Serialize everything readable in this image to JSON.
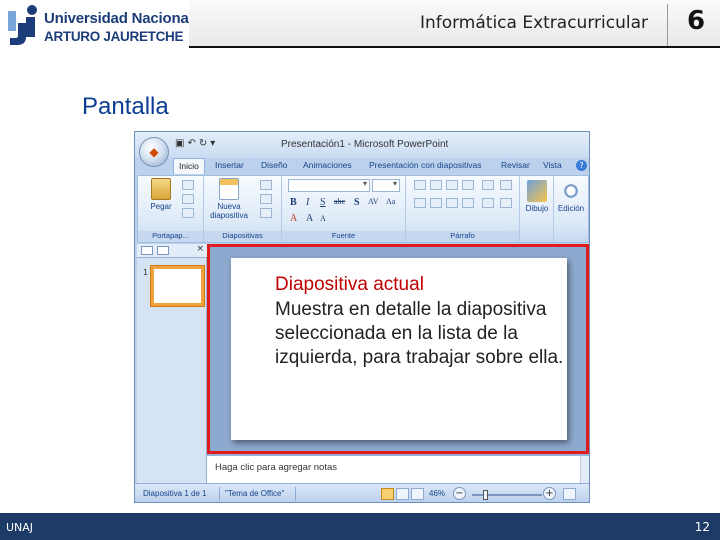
{
  "header": {
    "logo_line1": "Universidad Nacional",
    "logo_line2": "ARTURO JAURETCHE",
    "course_title": "Informática Extracurricular",
    "chapter_number": "6"
  },
  "slide": {
    "heading": "Pantalla"
  },
  "ppt": {
    "window_title": "Presentación1 - Microsoft PowerPoint",
    "tabs": [
      "Inicio",
      "Insertar",
      "Diseño",
      "Animaciones",
      "Presentación con diapositivas",
      "Revisar",
      "Vista"
    ],
    "active_tab": "Inicio",
    "ribbon": {
      "paste_label": "Pegar",
      "new_slide_label": "Nueva diapositiva",
      "drawing_label": "Dibujo",
      "editing_label": "Edición",
      "groups": [
        "Portapap...",
        "Diapositivas",
        "Fuente",
        "Párrafo"
      ]
    },
    "callout": {
      "title": "Diapositiva actual",
      "body": "Muestra en detalle la diapositiva seleccionada en la lista de la izquierda, para trabajar sobre ella."
    },
    "thumbnail_number": "1",
    "notes_placeholder": "Haga clic para agregar notas",
    "status": {
      "slide_info": "Diapositiva 1 de 1",
      "theme": "\"Tema de Office\"",
      "zoom": "46%",
      "zoom_level": 0.46
    }
  },
  "footer": {
    "left": "UNAJ",
    "page_number": "12"
  },
  "colors": {
    "brand_blue": "#1c3d7a",
    "footer_bar": "#1c3b66",
    "highlight_red": "#e01b1b",
    "callout_red": "#c00000"
  },
  "icons": [
    "university-logo-icon",
    "office-button-icon",
    "save-icon",
    "undo-icon",
    "redo-icon",
    "help-icon",
    "paste-icon",
    "new-slide-icon",
    "drawing-icon",
    "editing-icon",
    "view-normal-icon",
    "view-sorter-icon",
    "view-show-icon",
    "zoom-out-icon",
    "zoom-in-icon",
    "fit-window-icon"
  ]
}
